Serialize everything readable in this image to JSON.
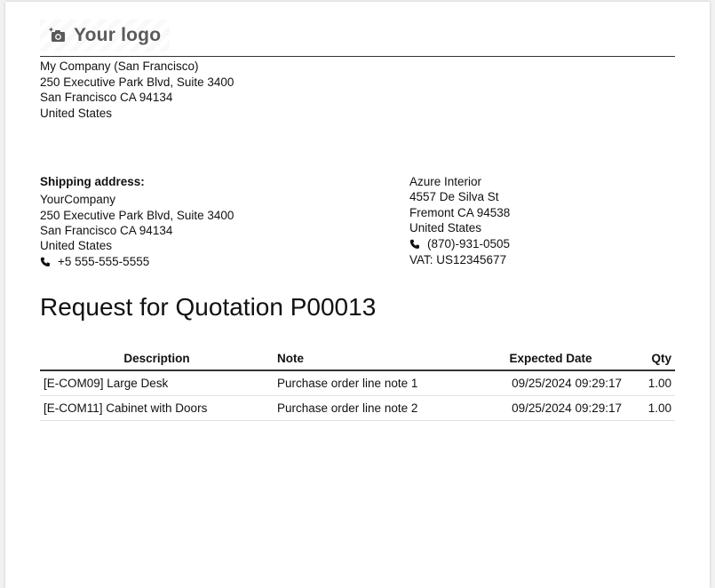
{
  "logo": {
    "text": "Your logo",
    "icon": "camera-icon"
  },
  "company": {
    "lines": [
      "My Company (San Francisco)",
      "250 Executive Park Blvd, Suite 3400",
      "San Francisco CA 94134",
      "United States"
    ]
  },
  "shipping": {
    "label": "Shipping address:",
    "lines": [
      "YourCompany",
      "250 Executive Park Blvd, Suite 3400",
      "San Francisco CA 94134",
      "United States"
    ],
    "phone": "+5 555-555-5555"
  },
  "vendor": {
    "lines": [
      "Azure Interior",
      "4557 De Silva St",
      "Fremont CA 94538",
      "United States"
    ],
    "phone": "(870)-931-0505",
    "vat": "VAT: US12345677"
  },
  "title": "Request for Quotation P00013",
  "table": {
    "headers": [
      "Description",
      "Note",
      "Expected Date",
      "Qty"
    ],
    "rows": [
      [
        "[E-COM09] Large Desk",
        "Purchase order line note 1",
        "09/25/2024 09:29:17",
        "1.00"
      ],
      [
        "[E-COM11] Cabinet with Doors",
        "Purchase order line note 2",
        "09/25/2024 09:29:17",
        "1.00"
      ]
    ]
  }
}
